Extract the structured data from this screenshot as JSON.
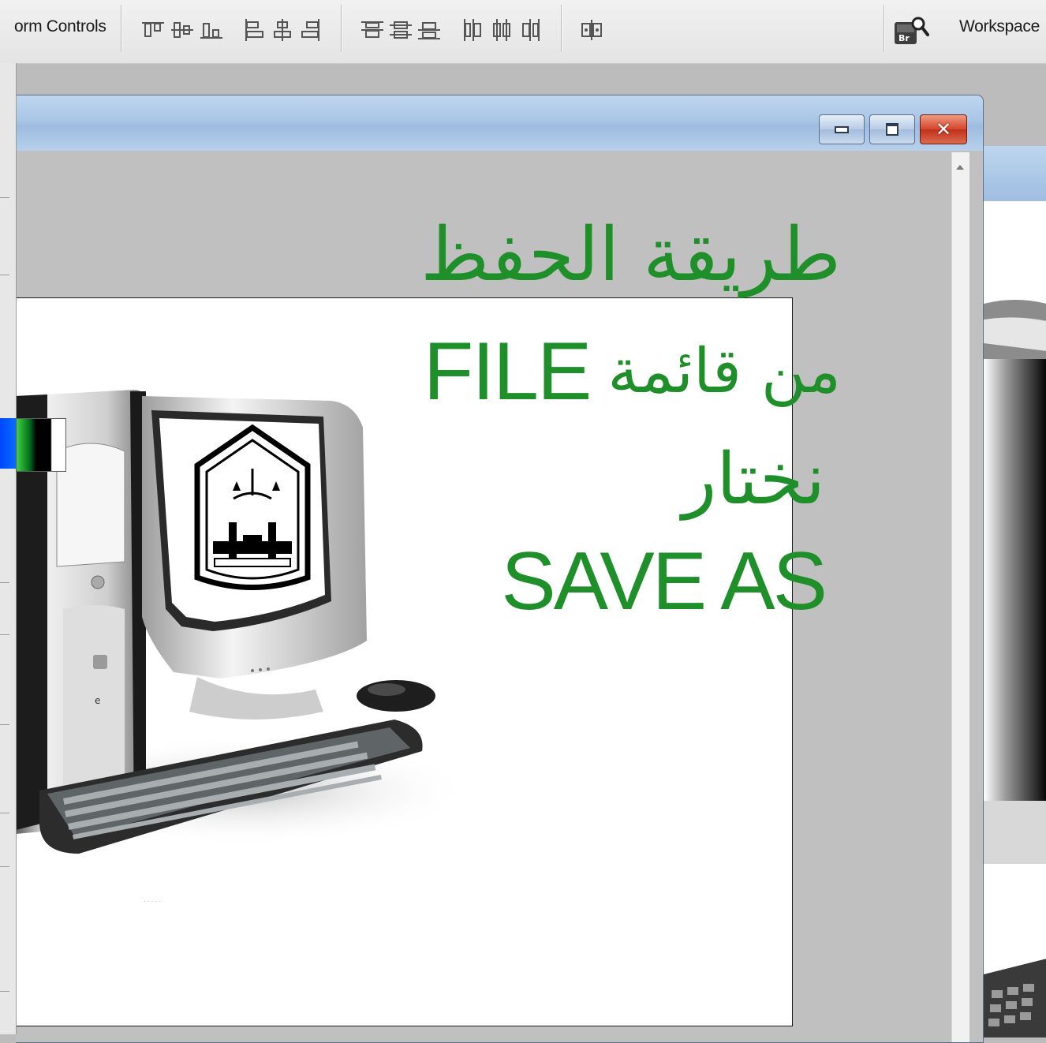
{
  "optionsBar": {
    "formControlsLabel": "orm Controls",
    "workspaceLabel": "Workspace",
    "icons": [
      "align-top-edges-icon",
      "align-vertical-centers-icon",
      "align-bottom-edges-icon",
      "align-left-edges-icon",
      "align-horizontal-centers-icon",
      "align-right-edges-icon",
      "distribute-top-edges-icon",
      "distribute-vertical-centers-icon",
      "distribute-bottom-edges-icon",
      "distribute-left-edges-icon",
      "distribute-horizontal-centers-icon",
      "distribute-right-edges-icon",
      "auto-align-layers-icon",
      "adobe-bridge-icon"
    ],
    "bridgeBadge": "Br"
  },
  "document": {
    "overlayLines": {
      "line1": "طريقة الحفظ",
      "line2Arabic": "من قائمة",
      "line2Latin": "FILE",
      "line3": "نختار",
      "line4": "SAVE AS"
    },
    "textColor": "#1f8f2a",
    "windowButtons": [
      "minimize",
      "maximize",
      "close"
    ]
  },
  "colors": {
    "foreground": "#0047ff",
    "background": "#3cd24c"
  }
}
